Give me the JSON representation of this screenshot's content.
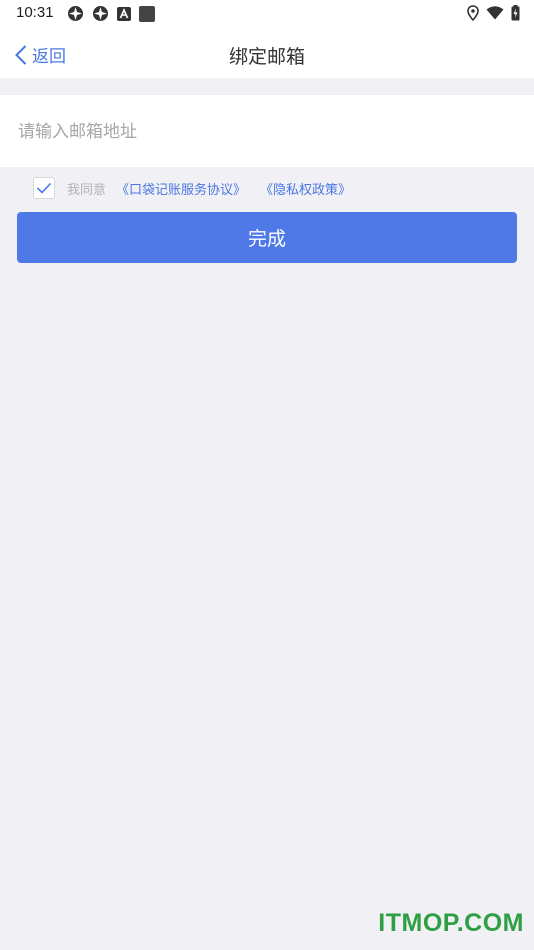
{
  "status_bar": {
    "time": "10:31",
    "left_icons": [
      "notification-icon",
      "notification-icon",
      "app-icon",
      "square-icon"
    ],
    "right_icons": [
      "location-icon",
      "wifi-icon",
      "battery-icon"
    ]
  },
  "nav": {
    "back_label": "返回",
    "title": "绑定邮箱"
  },
  "form": {
    "email_placeholder": "请输入邮箱地址",
    "email_value": "",
    "agree_checked": true,
    "agree_text": "我同意",
    "service_link": "《口袋记账服务协议》",
    "privacy_link": "《隐私权政策》",
    "submit_label": "完成"
  },
  "watermark": "ITMOP.COM",
  "colors": {
    "accent": "#4a77e4",
    "button": "#5079e8",
    "background": "#f0f0f5",
    "watermark": "#2ea043"
  }
}
